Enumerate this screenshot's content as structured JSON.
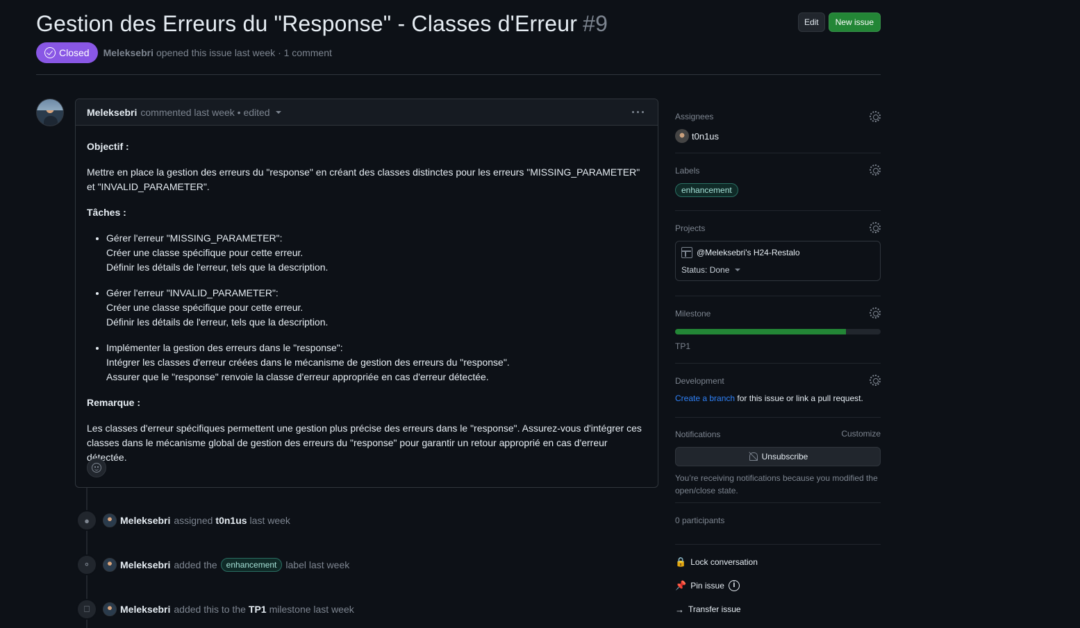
{
  "issue": {
    "title": "Gestion des Erreurs du \"Response\" - Classes d'Erreur",
    "number": "#9",
    "state": "Closed",
    "author": "Meleksebri",
    "meta_text": "opened this issue last week · 1 comment",
    "edit_label": "Edit",
    "new_issue_label": "New issue"
  },
  "comment": {
    "author": "Meleksebri",
    "meta": "commented last week • edited",
    "objectif_heading": "Objectif :",
    "objectif_text": "Mettre en place la gestion des erreurs du \"response\" en créant des classes distinctes pour les erreurs \"MISSING_PARAMETER\" et \"INVALID_PARAMETER\".",
    "taches_heading": "Tâches :",
    "tasks": [
      {
        "title": "Gérer l'erreur \"MISSING_PARAMETER\":",
        "line1": "Créer une classe spécifique pour cette erreur.",
        "line2": "Définir les détails de l'erreur, tels que la description."
      },
      {
        "title": "Gérer l'erreur \"INVALID_PARAMETER\":",
        "line1": "Créer une classe spécifique pour cette erreur.",
        "line2": "Définir les détails de l'erreur, tels que la description."
      },
      {
        "title": "Implémenter la gestion des erreurs dans le \"response\":",
        "line1": "Intégrer les classes d'erreur créées dans le mécanisme de gestion des erreurs du \"response\".",
        "line2": "Assurer que le \"response\" renvoie la classe d'erreur appropriée en cas d'erreur détectée."
      }
    ],
    "remarque_heading": "Remarque :",
    "remarque_text": "Les classes d'erreur spécifiques permettent une gestion plus précise des erreurs dans le \"response\". Assurez-vous d'intégrer ces classes dans le mécanisme global de gestion des erreurs du \"response\" pour garantir un retour approprié en cas d'erreur détectée."
  },
  "timeline": [
    {
      "icon": "person-icon",
      "who": "Meleksebri",
      "pre": "assigned",
      "target": "t0n1us",
      "post": "last week"
    },
    {
      "icon": "tag-icon",
      "who": "Meleksebri",
      "pre": "added the",
      "label": "enhancement",
      "post": "label last week"
    },
    {
      "icon": "milestone-icon",
      "who": "Meleksebri",
      "pre": "added this to the",
      "target": "TP1",
      "post": "milestone last week"
    }
  ],
  "sidebar": {
    "assignees_title": "Assignees",
    "assignee": "t0n1us",
    "labels_title": "Labels",
    "label": "enhancement",
    "projects_title": "Projects",
    "project_name": "@Meleksebri's H24-Restalo",
    "project_status": "Status: Done",
    "milestone_title": "Milestone",
    "milestone_progress": 0.83,
    "milestone_name": "TP1",
    "development_title": "Development",
    "dev_link": "Create a branch",
    "dev_text": " for this issue or link a pull request.",
    "notifications_title": "Notifications",
    "customize": "Customize",
    "unsubscribe": "Unsubscribe",
    "notif_note": "You’re receiving notifications because you modified the open/close state.",
    "participants": "0 participants",
    "lock": "Lock conversation",
    "pin": "Pin issue",
    "transfer": "Transfer issue"
  },
  "colors": {
    "closed": "#8957e5",
    "primary_green": "#238636",
    "link": "#2f81f7"
  }
}
